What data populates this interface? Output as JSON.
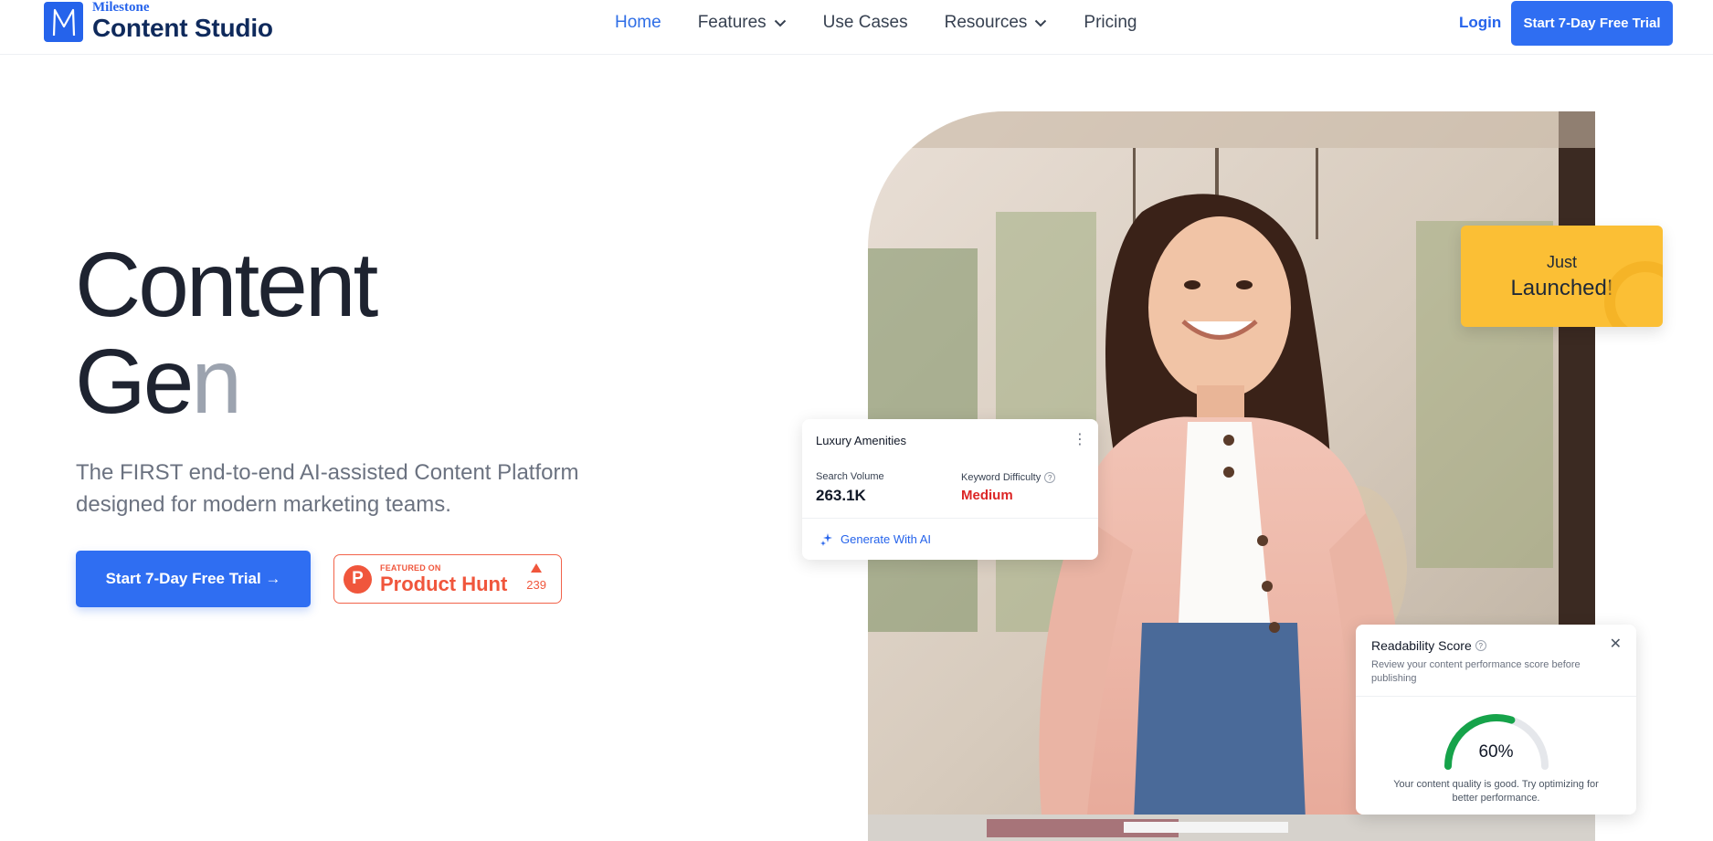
{
  "brand": {
    "sub": "Milestone",
    "name": "Content Studio",
    "mark": "M",
    "color": "#2563eb"
  },
  "nav": {
    "items": [
      {
        "label": "Home",
        "active": true
      },
      {
        "label": "Features",
        "dropdown": true
      },
      {
        "label": "Use Cases"
      },
      {
        "label": "Resources",
        "dropdown": true
      },
      {
        "label": "Pricing"
      }
    ],
    "login": "Login",
    "cta": "Start 7-Day Free Trial"
  },
  "hero": {
    "headline_line1": "Content",
    "headline_line2_dark": "Ge",
    "headline_line2_faded": "n",
    "subtitle": "The FIRST end-to-end AI-assisted Content Platform designed for modern marketing teams.",
    "cta": "Start 7-Day Free Trial",
    "cta_arrow": "→"
  },
  "product_hunt": {
    "small": "FEATURED ON",
    "big": "Product Hunt",
    "votes": "239",
    "logo": "P"
  },
  "launch_badge": {
    "line1": "Just",
    "line2": "Launched!"
  },
  "keyword_card": {
    "title": "Luxury Amenities",
    "search_volume_label": "Search Volume",
    "search_volume": "263.1K",
    "difficulty_label": "Keyword Difficulty",
    "difficulty": "Medium",
    "action": "Generate With AI"
  },
  "readability_card": {
    "title": "Readability Score",
    "description": "Review your content performance score before publishing",
    "score": 60,
    "score_text": "60%",
    "note": "Your content quality is good. Try optimizing for better performance."
  },
  "colors": {
    "accent": "#2f6ef2",
    "danger": "#dc2626",
    "gauge": "#16a34a",
    "badge": "#fbbf35",
    "producthunt": "#f0563c"
  }
}
